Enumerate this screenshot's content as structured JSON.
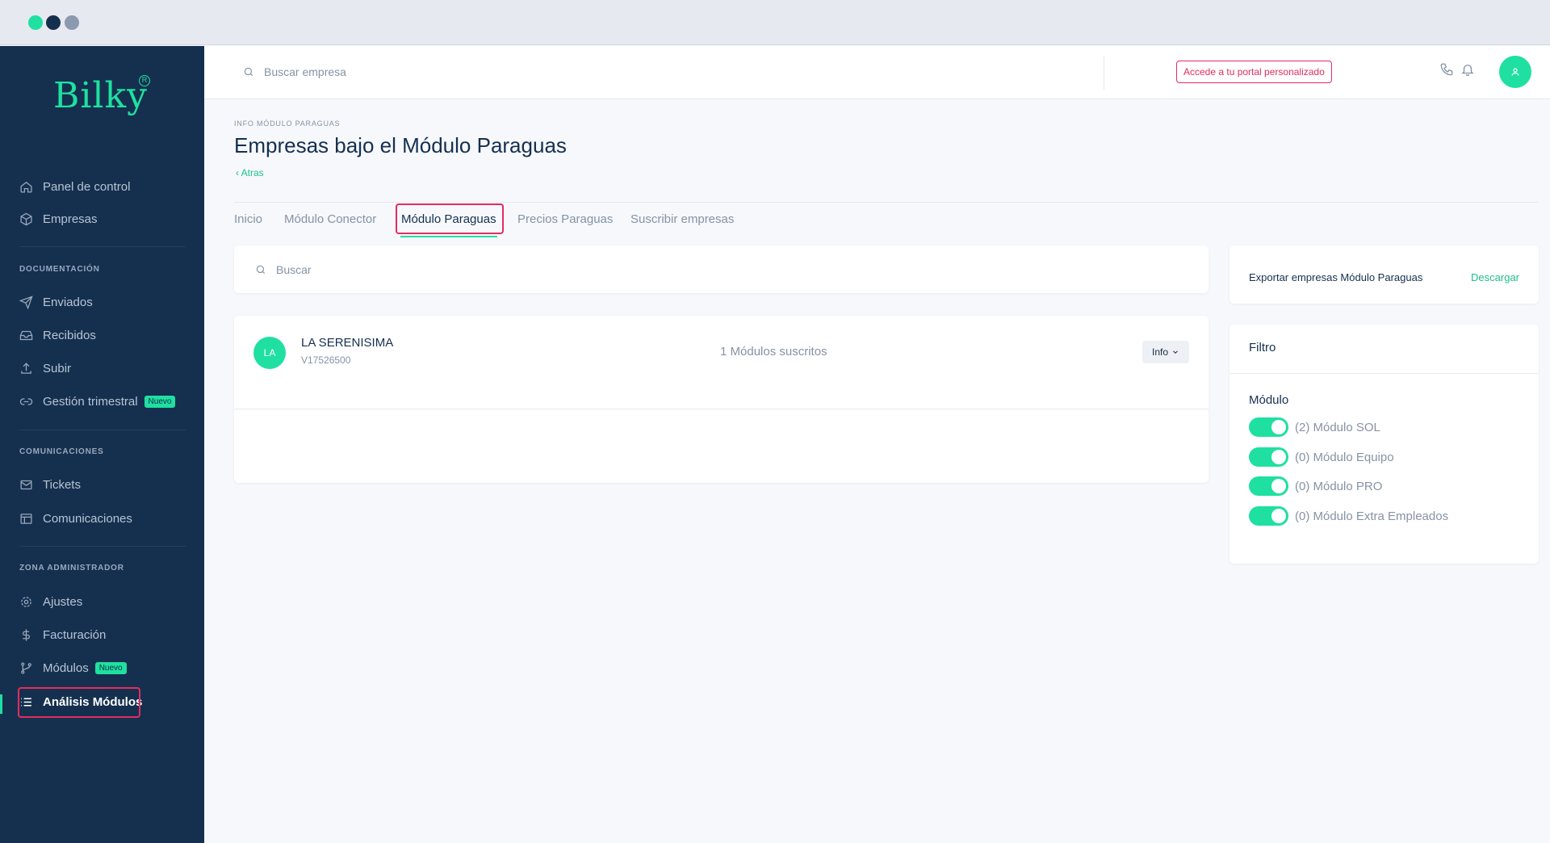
{
  "colors": {
    "accent": "#1fe0a0",
    "sidebar_bg": "#15304f",
    "highlight": "#e52b5f"
  },
  "brand": {
    "name": "Bilky",
    "mark": "R"
  },
  "sidebar": {
    "items_top": [
      {
        "label": "Panel de control",
        "icon": "home-icon"
      },
      {
        "label": "Empresas",
        "icon": "cube-icon"
      }
    ],
    "documentacion": {
      "title": "DOCUMENTACIÓN",
      "items": [
        {
          "label": "Enviados",
          "icon": "send-icon"
        },
        {
          "label": "Recibidos",
          "icon": "inbox-icon"
        },
        {
          "label": "Subir",
          "icon": "upload-icon"
        },
        {
          "label": "Gestión trimestral",
          "icon": "link-icon",
          "badge": "Nuevo"
        }
      ]
    },
    "comunicaciones": {
      "title": "COMUNICACIONES",
      "items": [
        {
          "label": "Tickets",
          "icon": "mail-icon"
        },
        {
          "label": "Comunicaciones",
          "icon": "layout-icon"
        }
      ]
    },
    "admin": {
      "title": "ZONA ADMINISTRADOR",
      "items": [
        {
          "label": "Ajustes",
          "icon": "gear-icon"
        },
        {
          "label": "Facturación",
          "icon": "dollar-icon"
        },
        {
          "label": "Módulos",
          "icon": "branch-icon",
          "badge": "Nuevo"
        },
        {
          "label": "Análisis Módulos",
          "icon": "list-icon",
          "active": true
        }
      ]
    }
  },
  "topbar": {
    "search_placeholder": "Buscar empresa",
    "portal_button": "Accede a tu portal personalizado"
  },
  "header": {
    "breadcrumb": "INFO MÓDULO PARAGUAS",
    "title": "Empresas bajo el Módulo Paraguas",
    "back": "‹ Atras"
  },
  "tabs": [
    {
      "label": "Inicio"
    },
    {
      "label": "Módulo Conector"
    },
    {
      "label": "Módulo Paraguas",
      "active": true
    },
    {
      "label": "Precios Paraguas"
    },
    {
      "label": "Suscribir empresas"
    }
  ],
  "main": {
    "search_placeholder": "Buscar",
    "company": {
      "initials": "LA",
      "name": "LA SERENISIMA",
      "id": "V17526500",
      "modules": "1 Módulos suscritos",
      "info_button": "Info"
    }
  },
  "export": {
    "label": "Exportar empresas Módulo Paraguas",
    "link": "Descargar"
  },
  "filter": {
    "title": "Filtro",
    "subtitle": "Módulo",
    "options": [
      {
        "label": "(2) Módulo SOL",
        "on": true
      },
      {
        "label": "(0) Módulo Equipo",
        "on": true
      },
      {
        "label": "(0) Módulo PRO",
        "on": true
      },
      {
        "label": "(0) Módulo Extra Empleados",
        "on": true
      }
    ]
  }
}
